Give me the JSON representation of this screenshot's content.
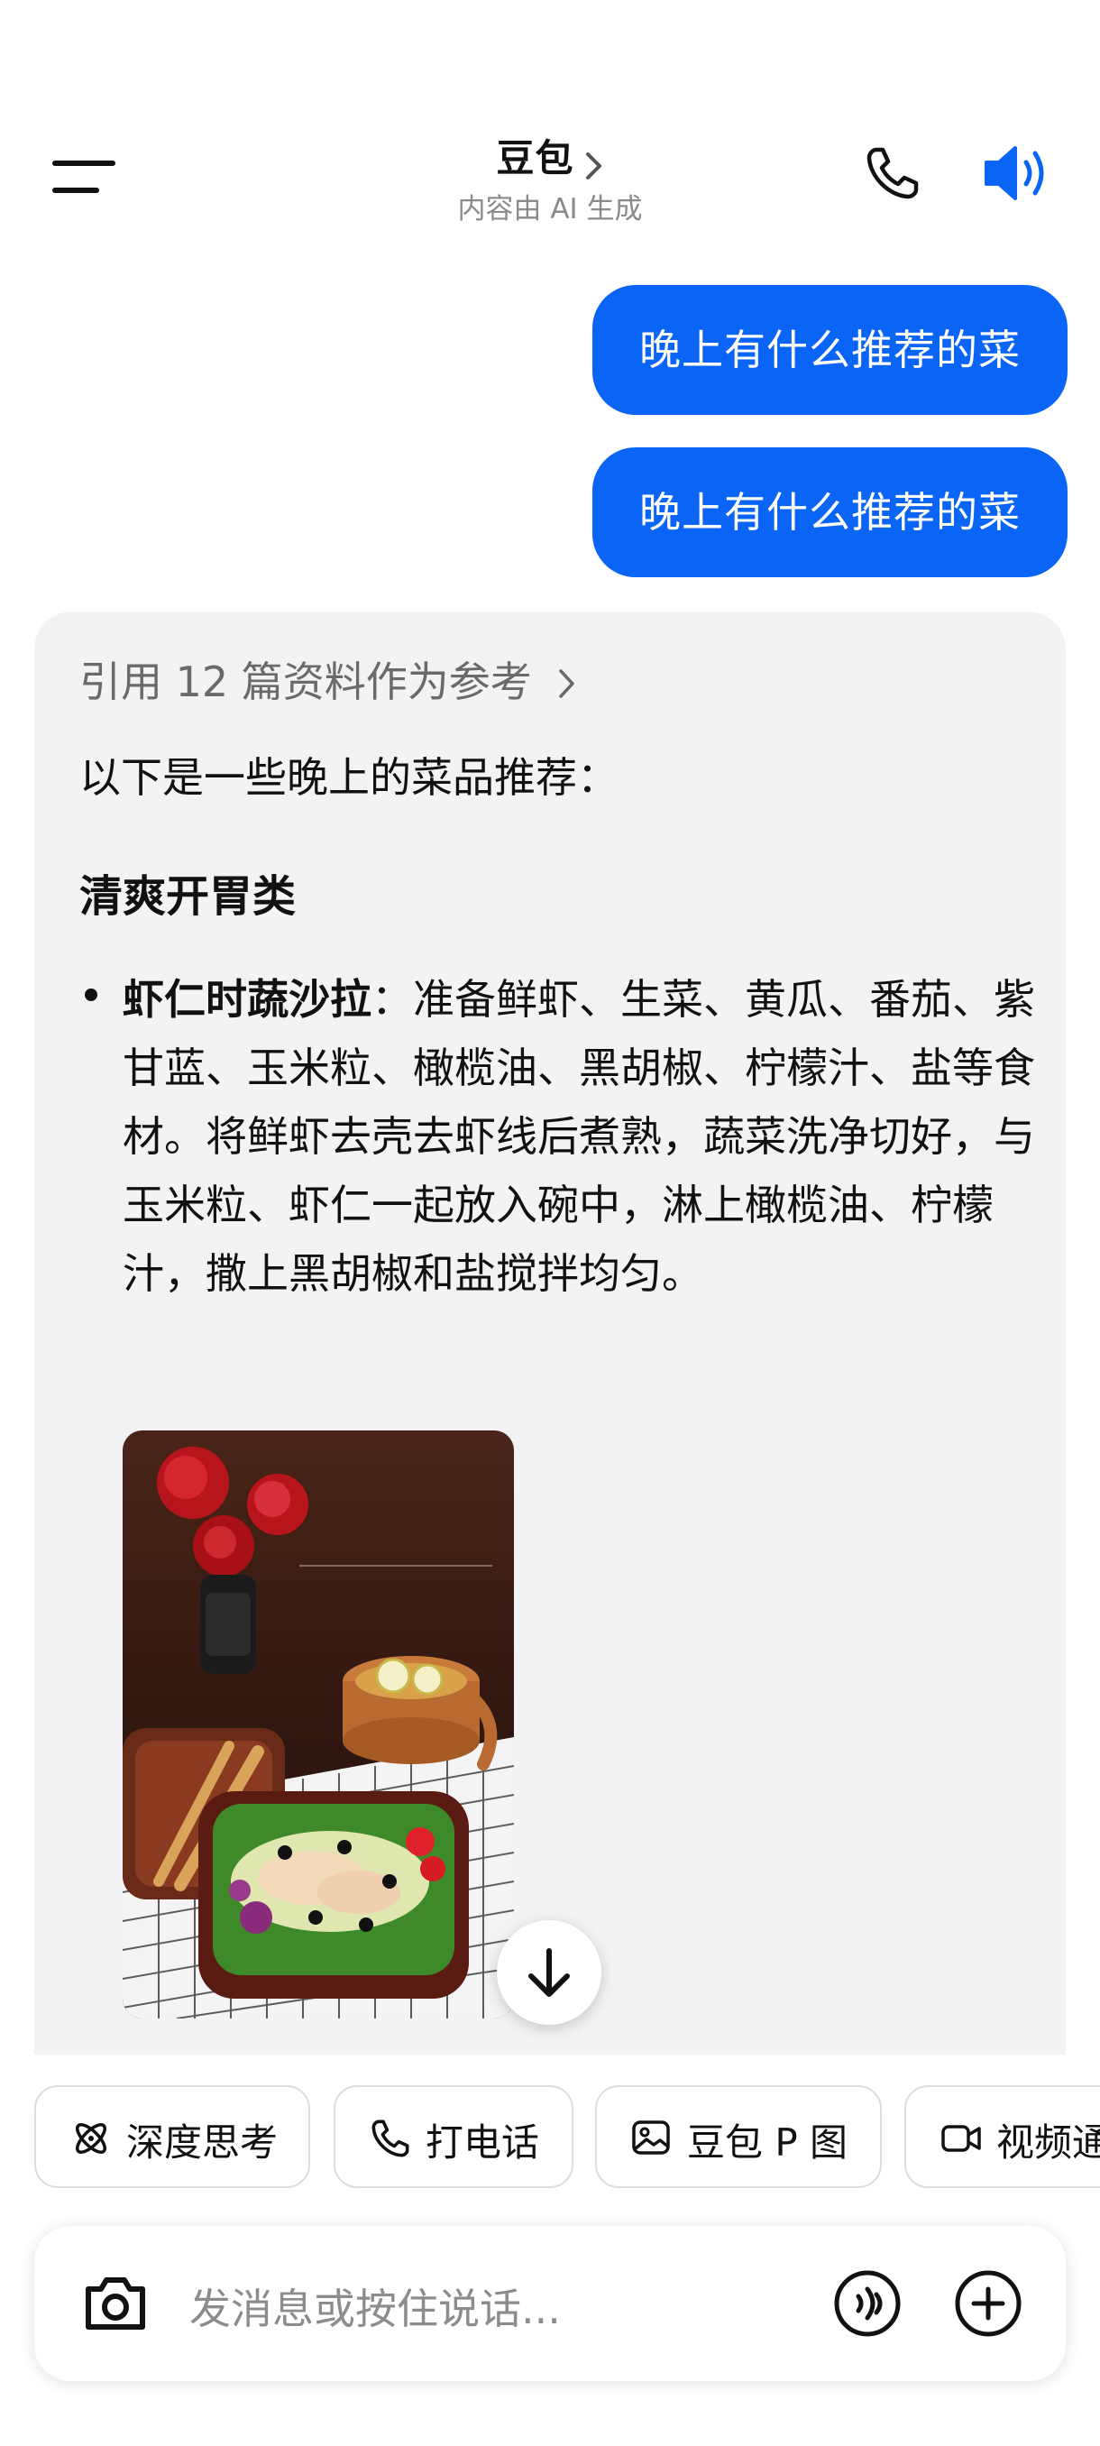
{
  "header": {
    "title": "豆包",
    "subtitle": "内容由 AI 生成"
  },
  "messages": {
    "user": [
      {
        "text": "晚上有什么推荐的菜"
      },
      {
        "text": "晚上有什么推荐的菜"
      }
    ],
    "answer": {
      "reference": "引用 12 篇资料作为参考",
      "intro": "以下是一些晚上的菜品推荐：",
      "section_title": "清爽开胃类",
      "bullet": {
        "title": "虾仁时蔬沙拉",
        "body": "：准备鲜虾、生菜、黄瓜、番茄、紫甘蓝、玉米粒、橄榄油、黑胡椒、柠檬汁、盐等食材。将鲜虾去壳去虾线后煮熟，蔬菜洗净切好，与玉米粒、虾仁一起放入碗中，淋上橄榄油、柠檬汁，撒上黑胡椒和盐搅拌均匀。"
      }
    }
  },
  "chips": [
    {
      "label": "深度思考",
      "icon": "atom-icon"
    },
    {
      "label": "打电话",
      "icon": "phone-icon"
    },
    {
      "label": "豆包 P 图",
      "icon": "image-edit-icon"
    },
    {
      "label": "视频通",
      "icon": "video-icon"
    }
  ],
  "composer": {
    "placeholder": "发消息或按住说话..."
  },
  "colors": {
    "accent": "#0a64f5",
    "card_bg": "#f3f3f5"
  }
}
